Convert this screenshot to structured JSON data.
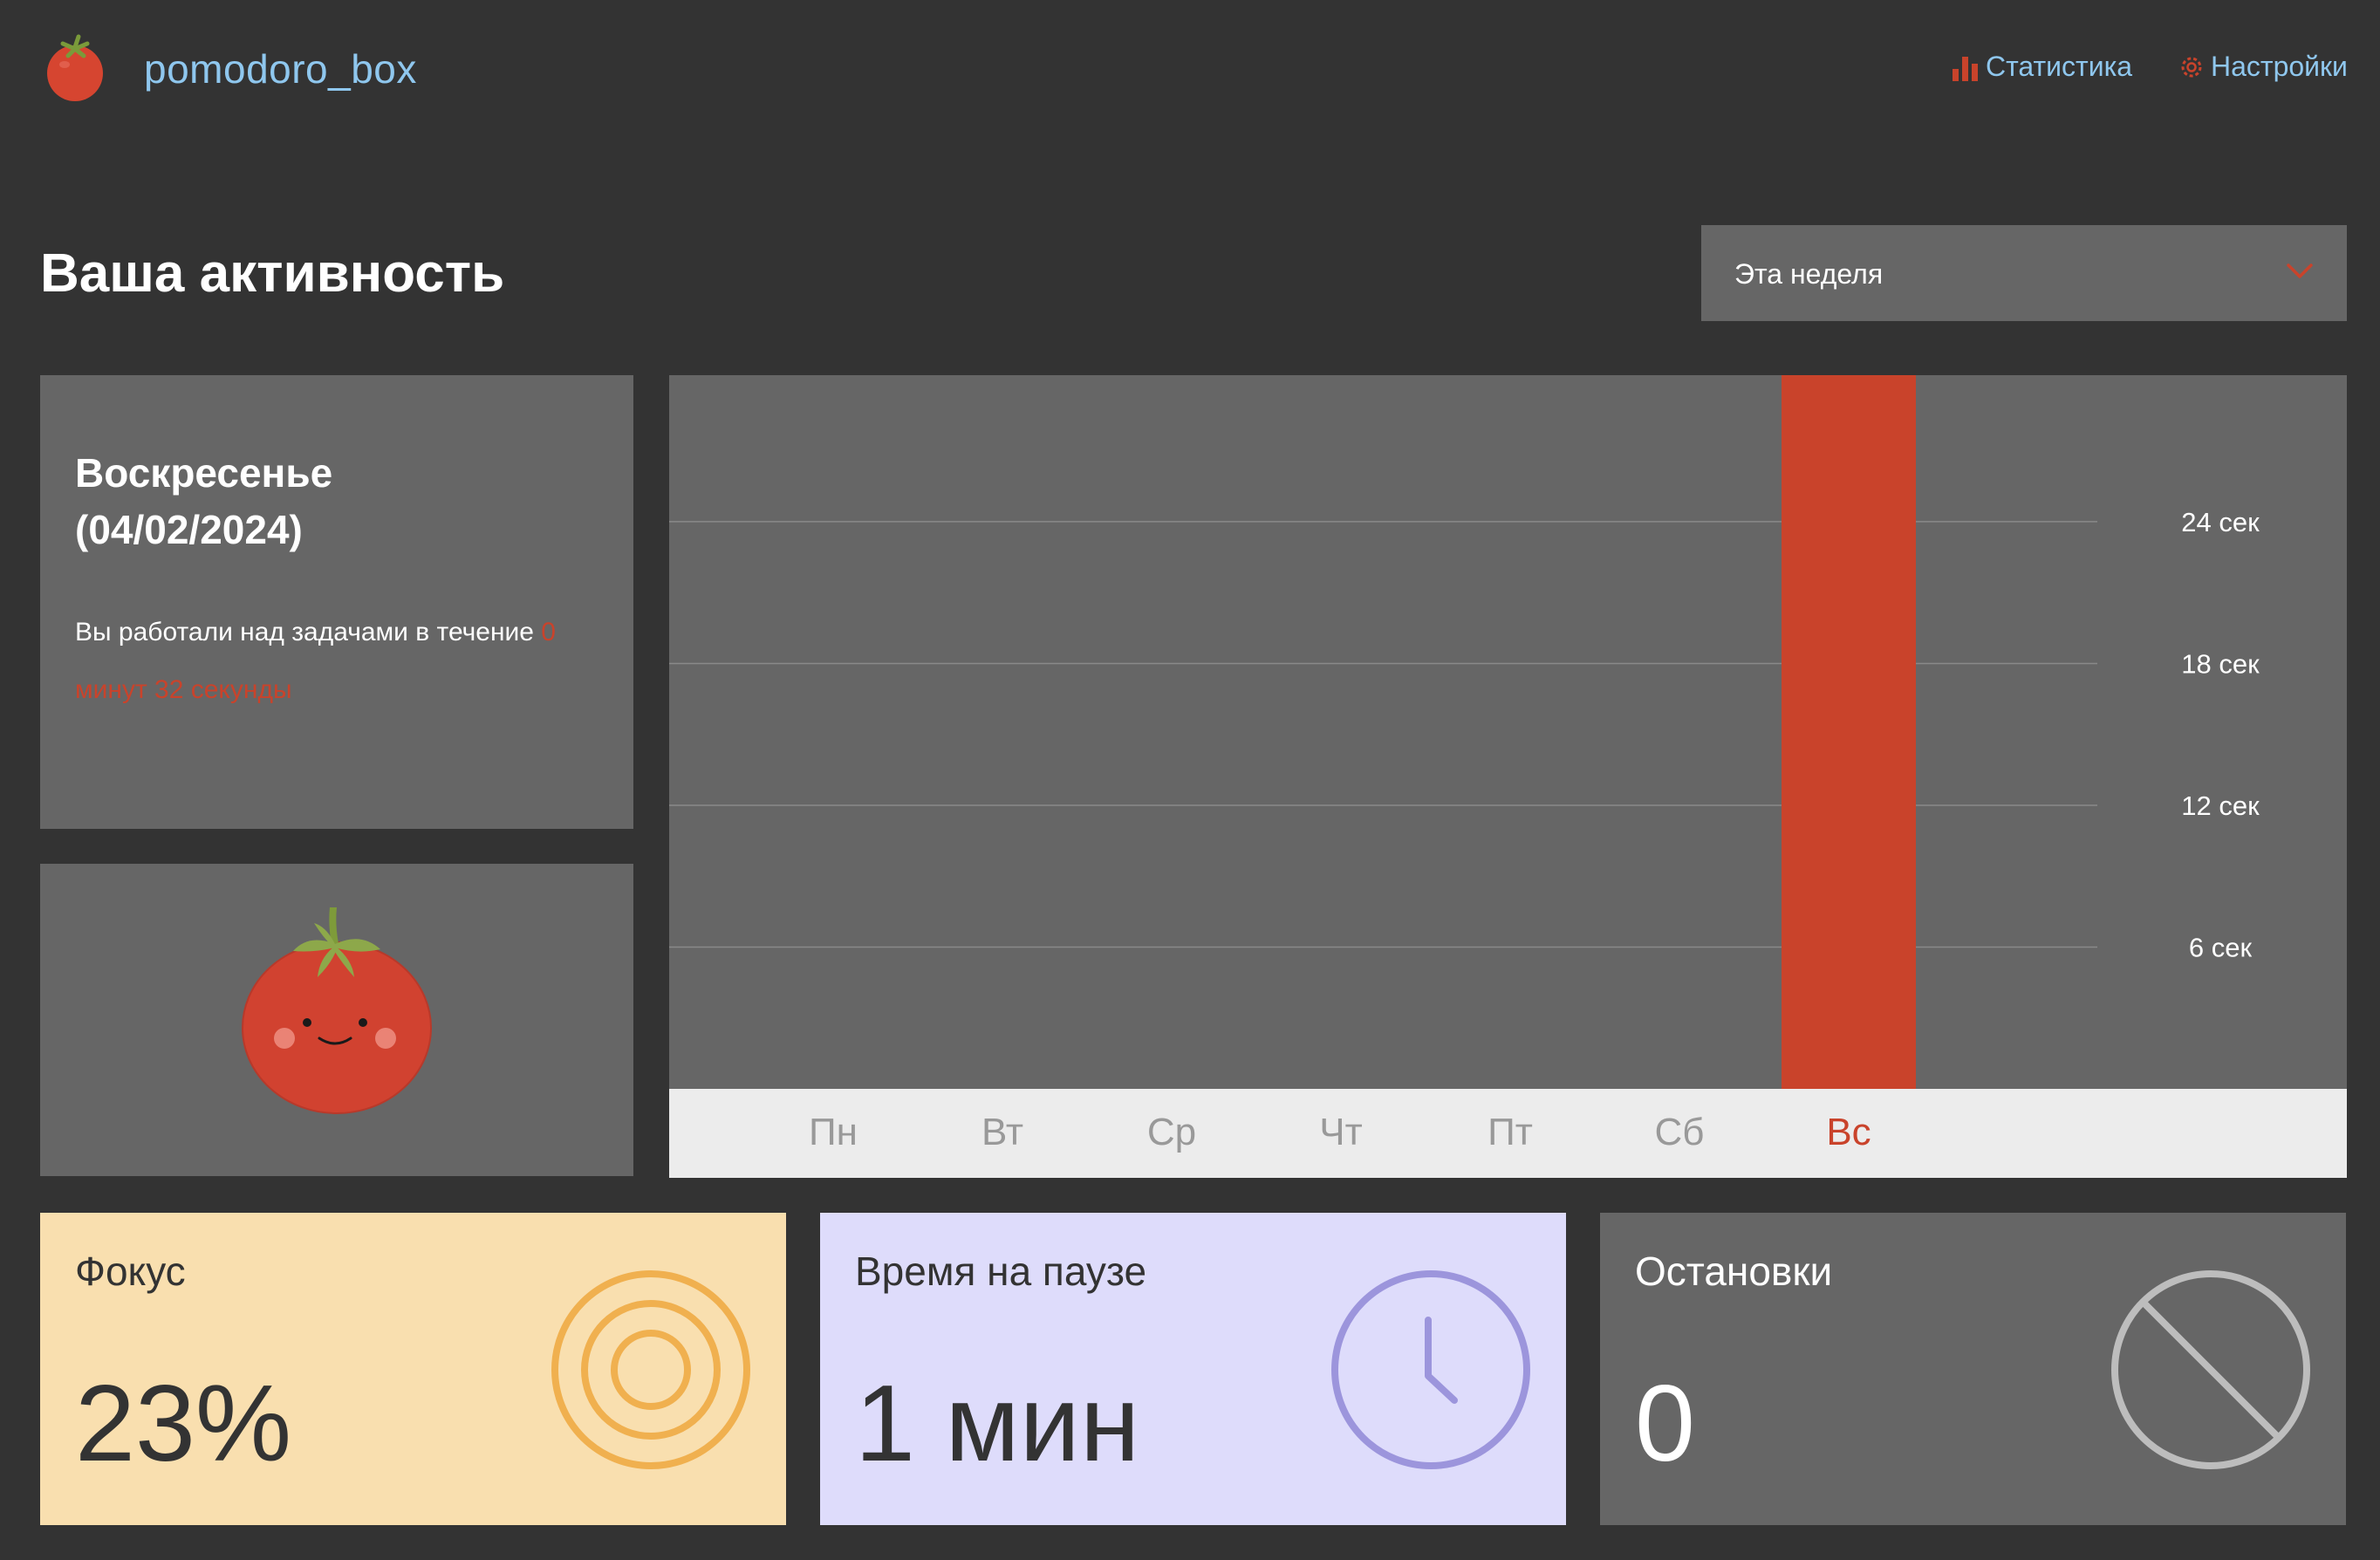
{
  "header": {
    "app_name": "pomodoro_box",
    "nav": {
      "stats": "Статистика",
      "settings": "Настройки"
    }
  },
  "page_title": "Ваша активность",
  "period_select": {
    "value": "Эта неделя"
  },
  "day_card": {
    "title_line1": "Воскресенье",
    "title_line2": "(04/02/2024)",
    "text": "Вы работали над задачами в течение ",
    "duration": "0 минут 32 секунды"
  },
  "stats": {
    "focus": {
      "title": "Фокус",
      "value": "23%"
    },
    "pause": {
      "title": "Время на паузе",
      "value": "1 мин"
    },
    "stops": {
      "title": "Остановки",
      "value": "0"
    }
  },
  "colors": {
    "accent": "#c9432b",
    "background": "#333333",
    "panel": "#666666",
    "link": "#8fc7ee",
    "focus": "#f9dfaf",
    "pause": "#dedcfb"
  },
  "chart_data": {
    "type": "bar",
    "categories": [
      "Пн",
      "Вт",
      "Ср",
      "Чт",
      "Пт",
      "Сб",
      "Вс"
    ],
    "values": [
      0,
      0,
      0,
      0,
      0,
      0,
      32
    ],
    "selected": "Вс",
    "yticks": [
      {
        "value": 6,
        "label": "6 сек"
      },
      {
        "value": 12,
        "label": "12 сек"
      },
      {
        "value": 18,
        "label": "18 сек"
      },
      {
        "value": 24,
        "label": "24 сек"
      }
    ],
    "ylim": [
      0,
      30.2
    ],
    "grid": true
  }
}
